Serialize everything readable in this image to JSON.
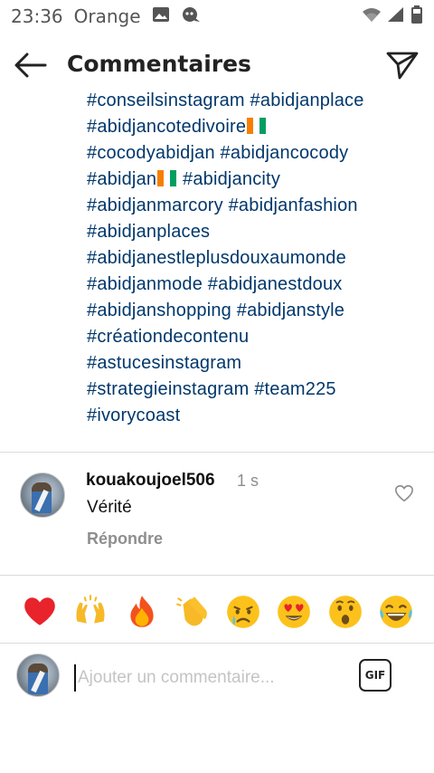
{
  "status_bar": {
    "time": "23:36",
    "carrier": "Orange"
  },
  "header": {
    "title": "Commentaires"
  },
  "caption": {
    "lines": [
      {
        "text": "#conseilsinstagram #abidjanplace",
        "flag": false
      },
      {
        "text": "#abidjancotedivoire",
        "flag": true
      },
      {
        "text": "#cocodyabidjan #abidjancocody",
        "flag": false
      },
      {
        "text": "#abidjan",
        "flag": true,
        "suffix": " #abidjancity"
      },
      {
        "text": "#abidjanmarcory #abidjanfashion",
        "flag": false
      },
      {
        "text": "#abidjanplaces",
        "flag": false
      },
      {
        "text": "#abidjanestleplusdouxaumonde",
        "flag": false
      },
      {
        "text": "#abidjanmode #abidjanestdoux",
        "flag": false
      },
      {
        "text": "#abidjanshopping #abidjanstyle",
        "flag": false
      },
      {
        "text": "#créationdecontenu",
        "flag": false
      },
      {
        "text": "#astucesinstagram",
        "flag": false
      },
      {
        "text": "#strategieinstagram #team225",
        "flag": false
      },
      {
        "text": "#ivorycoast",
        "flag": false
      }
    ],
    "flag_colors": [
      "#f77f00",
      "#ffffff",
      "#009e60"
    ]
  },
  "comment": {
    "username": "kouakoujoel506",
    "time": "1 s",
    "text": "Vérité",
    "reply_label": "Répondre"
  },
  "emoji_bar": {
    "emojis": [
      "❤️",
      "🙌",
      "🔥",
      "👏",
      "😢",
      "😍",
      "😮",
      "😂"
    ]
  },
  "composer": {
    "placeholder": "Ajouter un commentaire...",
    "gif_label": "GIF"
  },
  "colors": {
    "hashtag": "#00376b",
    "muted": "#8e8e8e",
    "divider": "#dbdbdb"
  }
}
